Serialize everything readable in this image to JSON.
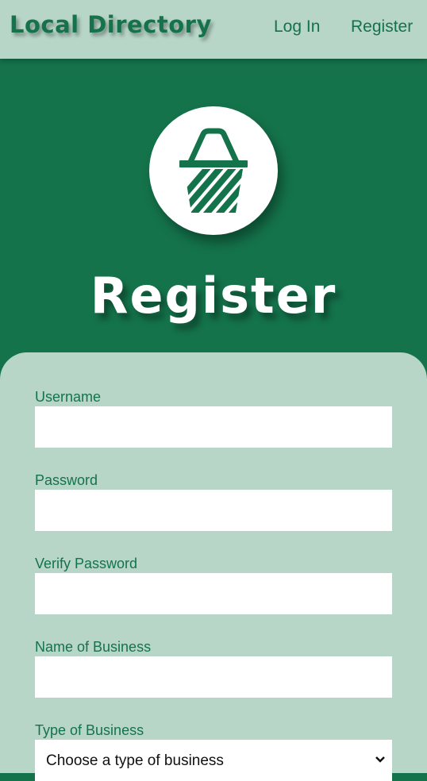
{
  "header": {
    "brand": "Local Directory",
    "nav": {
      "login_label": "Log In",
      "register_label": "Register"
    }
  },
  "hero": {
    "icon": "basket-icon",
    "title": "Register"
  },
  "form": {
    "username": {
      "label": "Username",
      "value": ""
    },
    "password": {
      "label": "Password",
      "value": ""
    },
    "verify_password": {
      "label": "Verify Password",
      "value": ""
    },
    "business_name": {
      "label": "Name of Business",
      "value": ""
    },
    "business_type": {
      "label": "Type of Business",
      "selected": "Choose a type of business"
    }
  },
  "colors": {
    "primary_green": "#14734b",
    "light_green": "#b8d6c8",
    "white": "#ffffff"
  }
}
